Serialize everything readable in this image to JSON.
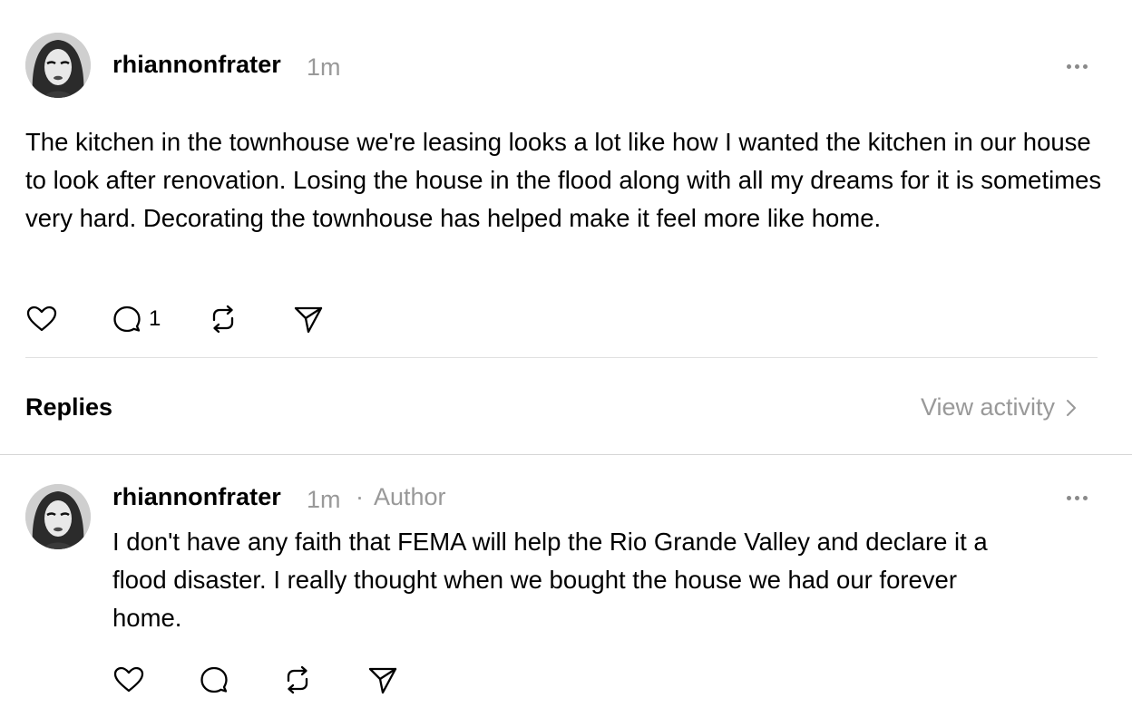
{
  "post": {
    "username": "rhiannonfrater",
    "time": "1m",
    "text": "The kitchen in the townhouse we're leasing looks a lot like how I wanted the kitchen in our house to look after renovation. Losing the house in the flood along with all my dreams for it is sometimes very hard. Decorating the townhouse has helped make it feel more like home.",
    "reply_count": "1",
    "icons": {
      "more": "more-horizontal-icon",
      "like": "heart-icon",
      "reply": "comment-icon",
      "repost": "repost-icon",
      "share": "send-icon"
    }
  },
  "replies_section": {
    "title": "Replies",
    "view_activity": "View activity"
  },
  "reply": {
    "username": "rhiannonfrater",
    "time": "1m",
    "separator": "·",
    "badge": "Author",
    "text": "I don't have any faith that FEMA will help the Rio Grande Valley and declare it a flood disaster. I really thought when we bought the house we had our forever home."
  },
  "colors": {
    "text": "#000000",
    "muted": "#999999",
    "divider": "#e0e0e0"
  }
}
